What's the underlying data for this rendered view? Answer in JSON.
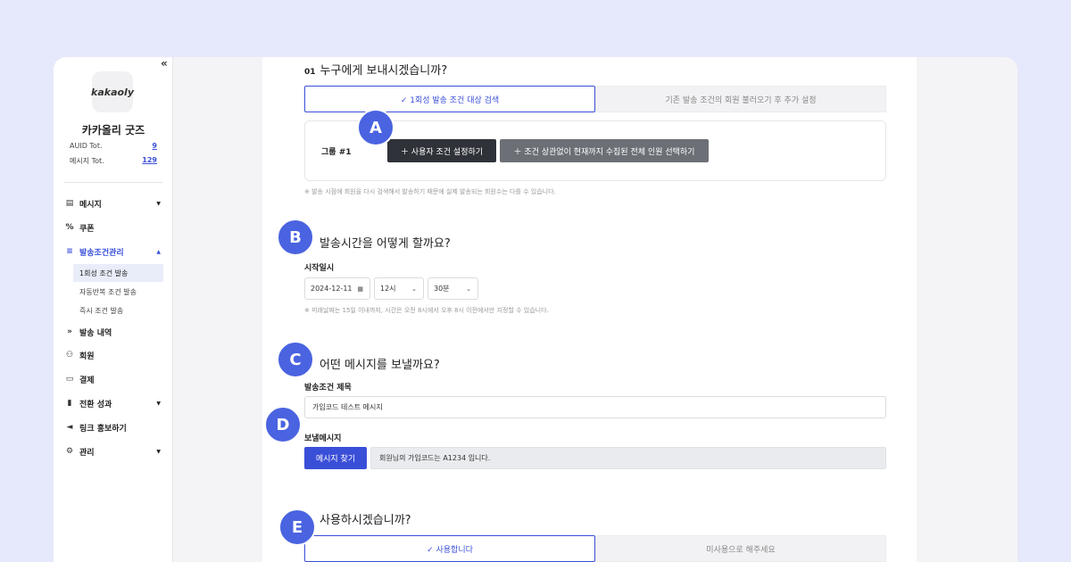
{
  "sidebar": {
    "collapse": "«",
    "logo": "kakaoly",
    "shop_name": "카카올리 굿즈",
    "stats": [
      {
        "label": "AUID Tot.",
        "value": "9"
      },
      {
        "label": "메시지 Tot.",
        "value": "129"
      }
    ],
    "nav": [
      {
        "label": "메시지",
        "icon": "message-icon",
        "glyph": "▤",
        "caret": "▼"
      },
      {
        "label": "쿠폰",
        "icon": "percent-icon",
        "glyph": "%",
        "caret": ""
      },
      {
        "label": "발송조건관리",
        "icon": "search-list-icon",
        "glyph": "≡",
        "caret": "▲"
      },
      {
        "label": "발송 내역",
        "icon": "send-icon",
        "glyph": "»",
        "caret": ""
      },
      {
        "label": "회원",
        "icon": "users-icon",
        "glyph": "⚇",
        "caret": ""
      },
      {
        "label": "결제",
        "icon": "card-icon",
        "glyph": "▭",
        "caret": ""
      },
      {
        "label": "전환 성과",
        "icon": "bar-chart-icon",
        "glyph": "▮",
        "caret": "▼"
      },
      {
        "label": "링크 홍보하기",
        "icon": "megaphone-icon",
        "glyph": "◄",
        "caret": ""
      },
      {
        "label": "관리",
        "icon": "gear-icon",
        "glyph": "⚙",
        "caret": "▼"
      }
    ],
    "subnav": [
      "1회성 조건 발송",
      "자동반복 조건 발송",
      "즉시 조건 발송"
    ]
  },
  "section1": {
    "num": "01",
    "title": "누구에게 보내시겠습니까?",
    "opt_on": "✓ 1회성 발송 조건 대상 검색",
    "opt_off": "기존 발송 조건의 회원 불러오기 후 추가 설정",
    "group_label": "그룹 #1",
    "btn_user": "＋  사용자 조건 설정하기",
    "btn_all": "＋  조건 상관없이 현재까지 수집된 전체 인원 선택하기",
    "note": "※ 발송 시점에 회원을 다시 검색해서 발송하기 때문에 실제 발송되는 회원수는 다를 수 있습니다."
  },
  "section2": {
    "title": "발송시간을 어떻게 할까요?",
    "start_label": "시작일시",
    "date": "2024-12-11",
    "hour": "12시",
    "minute": "30분",
    "note": "※ 미래날짜는 15일 이내까지, 시간은 오전 8시에서 오후 8시 이전에서만 지정할 수 있습니다."
  },
  "section3": {
    "title": "어떤 메시지를 보낼까요?",
    "cond_title_label": "발송조건 제목",
    "cond_title_value": "가입코드 테스트 메시지",
    "message_label": "보낼메시지",
    "find_btn": "메시지 찾기",
    "message_value": "회원님의 가입코드는 A1234 입니다."
  },
  "section4": {
    "title_partial": "사용하시겠습니까?",
    "opt_on": "✓ 사용합니다",
    "opt_off": "미사용으로 해주세요"
  },
  "markers": [
    "A",
    "B",
    "C",
    "D",
    "E"
  ],
  "colors": {
    "accent": "#3a4fd8",
    "marker": "#4a63e0",
    "dark_btn": "#2f3238",
    "gray_btn": "#6c7076",
    "background": "#e6e9fb"
  }
}
